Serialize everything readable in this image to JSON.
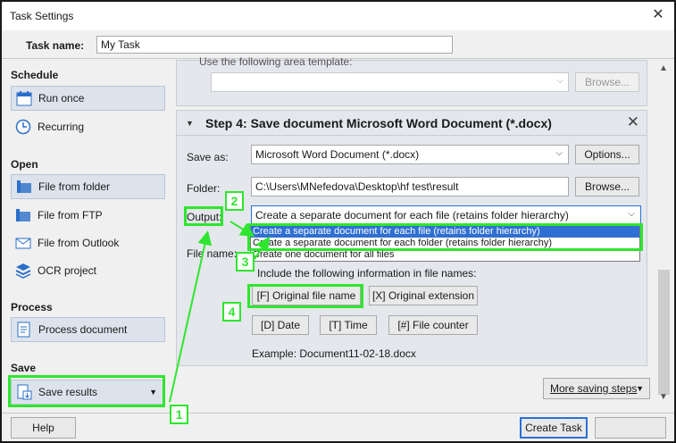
{
  "window": {
    "title": "Task Settings",
    "close_glyph": "✕"
  },
  "task_name": {
    "label": "Task name:",
    "value": "My Task"
  },
  "sidebar": {
    "schedule_heading": "Schedule",
    "schedule_items": [
      {
        "label": "Run once",
        "icon": "calendar-icon"
      },
      {
        "label": "Recurring",
        "icon": "clock-icon"
      }
    ],
    "open_heading": "Open",
    "open_items": [
      {
        "label": "File from folder",
        "icon": "folder-icon"
      },
      {
        "label": "File from FTP",
        "icon": "ftp-folder-icon"
      },
      {
        "label": "File from Outlook",
        "icon": "mail-icon"
      },
      {
        "label": "OCR project",
        "icon": "ocr-project-icon"
      }
    ],
    "process_heading": "Process",
    "process_items": [
      {
        "label": "Process document",
        "icon": "document-icon"
      }
    ],
    "save_heading": "Save",
    "save_items": [
      {
        "label": "Save results",
        "icon": "save-results-icon"
      }
    ]
  },
  "prev_step": {
    "radio_text": "Use the following area template:",
    "browse": "Browse..."
  },
  "step4": {
    "title": "Step 4: Save document Microsoft Word Document (*.docx)",
    "save_as_label": "Save as:",
    "save_as_value": "Microsoft Word Document (*.docx)",
    "options_button": "Options...",
    "folder_label": "Folder:",
    "folder_value": "C:\\Users\\MNefedova\\Desktop\\hf test\\result",
    "browse_button": "Browse...",
    "output_label": "Output:",
    "output_value": "Create a separate document for each file (retains folder hierarchy)",
    "output_options": [
      "Create a separate document for each file (retains folder hierarchy)",
      "Create a separate document for each folder (retains folder hierarchy)",
      "Create one document for all files"
    ],
    "file_name_label": "File name:",
    "include_text": "Include the following information in file names:",
    "tokens_row1": [
      "[F] Original file name",
      "[X] Original extension"
    ],
    "tokens_row2": [
      "[D] Date",
      "[T] Time",
      "[#] File counter"
    ],
    "example": "Example: Document11-02-18.docx"
  },
  "more_saving_steps": "More saving steps",
  "bottom": {
    "help": "Help",
    "create": "Create Task",
    "cancel": ""
  },
  "callouts": [
    "1",
    "2",
    "3",
    "4"
  ],
  "colors": {
    "highlight": "#2ee62e",
    "selected": "#2f6fd1",
    "accent": "#2a70d6"
  }
}
